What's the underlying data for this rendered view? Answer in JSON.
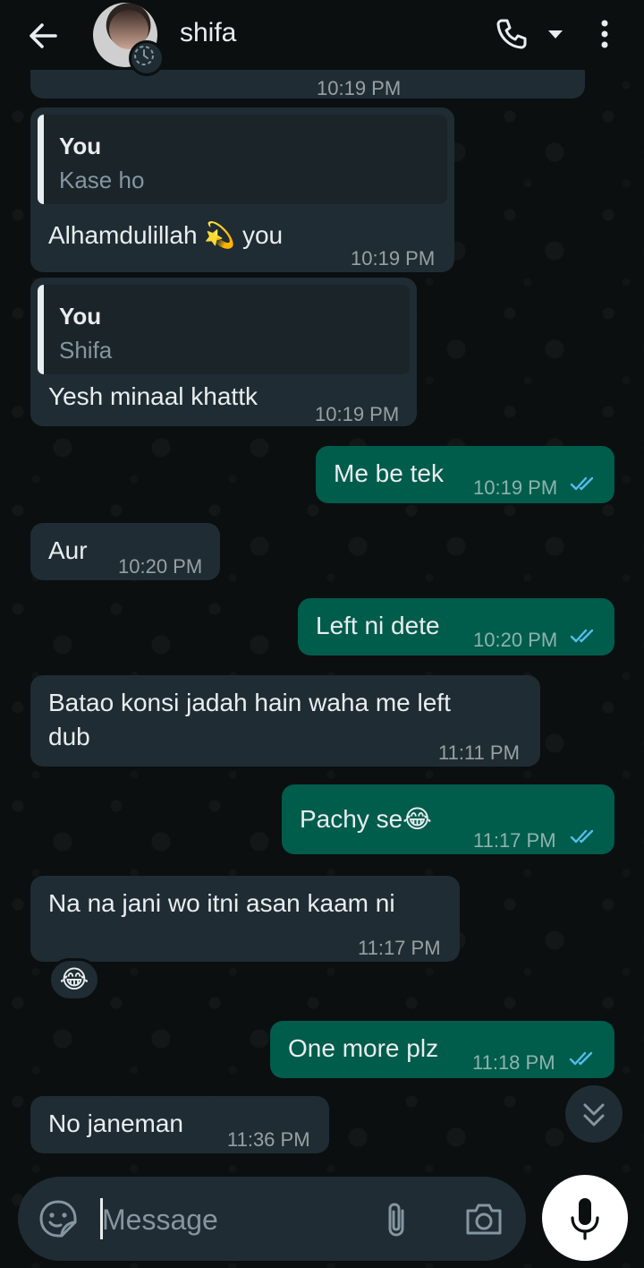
{
  "header": {
    "contact_name": "shifa",
    "icons": [
      "back-arrow-icon",
      "avatar",
      "status-icon",
      "phone-icon",
      "dropdown-icon",
      "more-vert-icon"
    ]
  },
  "messages": [
    {
      "dir": "in",
      "reply": {
        "author": "You",
        "text": "Kase ho"
      },
      "text": "Alhamdulillah 💫 you",
      "time": "10:19 PM"
    },
    {
      "dir": "in",
      "reply": {
        "author": "You",
        "text": "Shifa"
      },
      "text": "Yesh minaal khattk",
      "time": "10:19 PM"
    },
    {
      "dir": "out",
      "text": "Me be tek",
      "time": "10:19 PM",
      "status": "read"
    },
    {
      "dir": "in",
      "text": "Aur",
      "time": "10:20 PM"
    },
    {
      "dir": "out",
      "text": "Left ni dete",
      "time": "10:20 PM",
      "status": "read"
    },
    {
      "dir": "in",
      "text_line1": "Batao konsi jadah hain waha me left",
      "text_line2": "dub",
      "time": "11:11 PM"
    },
    {
      "dir": "out",
      "text": "Pachy se😂",
      "time": "11:17 PM",
      "status": "read"
    },
    {
      "dir": "in",
      "text": "Na na jani wo itni asan kaam ni",
      "time": "11:17 PM",
      "reaction": "😂"
    },
    {
      "dir": "out",
      "text": "One more plz",
      "time": "11:18 PM",
      "status": "read"
    },
    {
      "dir": "in",
      "text": "No janeman",
      "time": "11:36 PM"
    }
  ],
  "partial_time_top": "10:19 PM",
  "composer": {
    "placeholder": "Message",
    "icons": [
      "sticker-icon",
      "attach-icon",
      "camera-icon",
      "mic-icon"
    ]
  },
  "colors": {
    "background": "#0b0f10",
    "incoming": "#1f2c33",
    "outgoing": "#005c4b",
    "read_ticks": "#53bdeb"
  }
}
